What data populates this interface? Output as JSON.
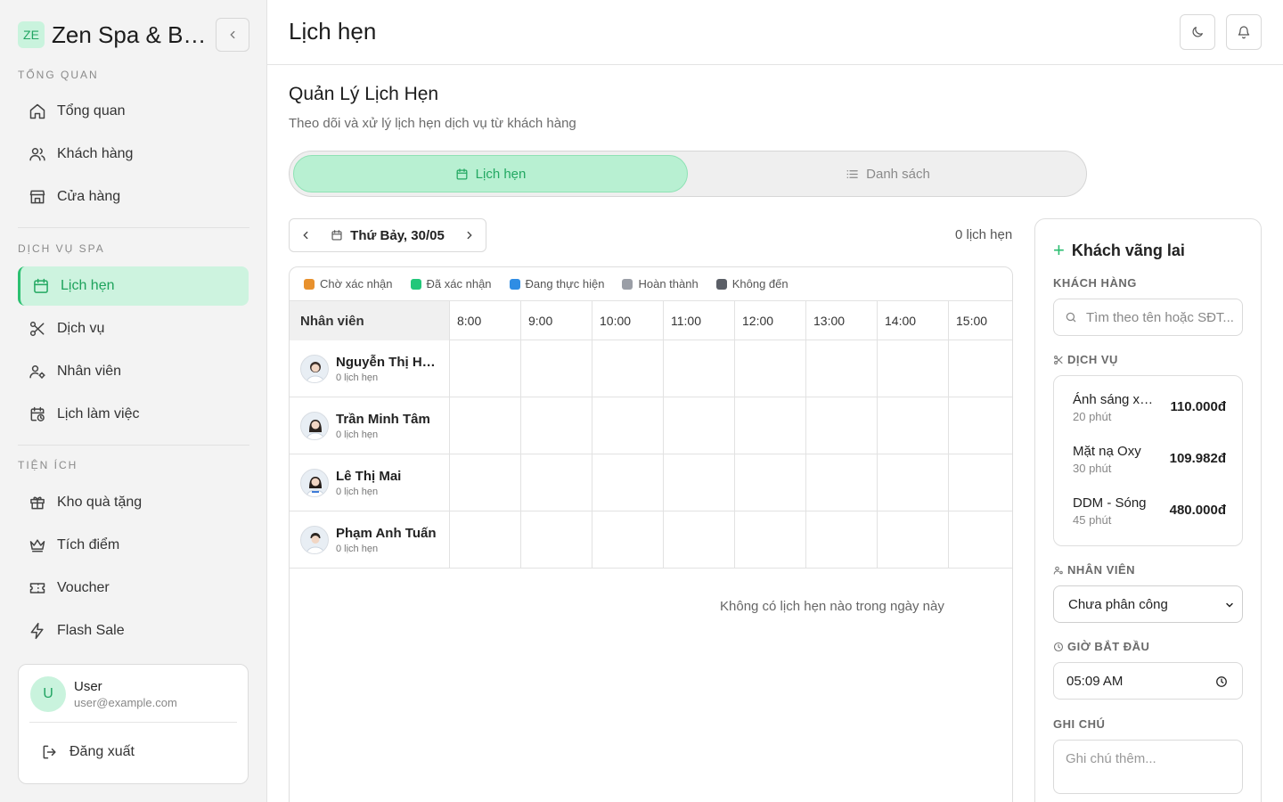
{
  "brand": {
    "badge": "ZE",
    "name": "Zen Spa & Beauty"
  },
  "sidebar": {
    "sections": [
      {
        "title": "TỔNG QUAN"
      },
      {
        "title": "DỊCH VỤ SPA"
      },
      {
        "title": "TIỆN ÍCH"
      }
    ],
    "items": [
      {
        "label": "Tổng quan",
        "icon": "home-icon"
      },
      {
        "label": "Khách hàng",
        "icon": "users-icon"
      },
      {
        "label": "Cửa hàng",
        "icon": "store-icon"
      },
      {
        "label": "Lịch hẹn",
        "icon": "calendar-icon",
        "active": true
      },
      {
        "label": "Dịch vụ",
        "icon": "scissors-icon"
      },
      {
        "label": "Nhân viên",
        "icon": "staff-icon"
      },
      {
        "label": "Lịch làm việc",
        "icon": "calendar-clock-icon"
      },
      {
        "label": "Kho quà tặng",
        "icon": "gift-icon"
      },
      {
        "label": "Tích điểm",
        "icon": "crown-icon"
      },
      {
        "label": "Voucher",
        "icon": "ticket-icon"
      },
      {
        "label": "Flash Sale",
        "icon": "zap-icon"
      }
    ],
    "user": {
      "avatar": "U",
      "name": "User",
      "email": "user@example.com",
      "logout": "Đăng xuất"
    }
  },
  "header": {
    "title": "Lịch hẹn"
  },
  "main": {
    "title": "Quản Lý Lịch Hẹn",
    "subtitle": "Theo dõi và xử lý lịch hẹn dịch vụ từ khách hàng",
    "tabs": [
      {
        "label": "Lịch hẹn"
      },
      {
        "label": "Danh sách"
      }
    ],
    "date": "Thứ Bảy, 30/05",
    "appointment_count": "0 lịch hẹn",
    "legend": [
      {
        "label": "Chờ xác nhận",
        "color": "#e8912d"
      },
      {
        "label": "Đã xác nhận",
        "color": "#22c77a"
      },
      {
        "label": "Đang thực hiện",
        "color": "#2f8de4"
      },
      {
        "label": "Hoàn thành",
        "color": "#9a9ea6"
      },
      {
        "label": "Không đến",
        "color": "#5b5f67"
      }
    ],
    "staff_header": "Nhân viên",
    "hours": [
      "8:00",
      "9:00",
      "10:00",
      "11:00",
      "12:00",
      "13:00",
      "14:00",
      "15:00"
    ],
    "staff": [
      {
        "name": "Nguyễn Thị Hồng",
        "count": "0 lịch hẹn"
      },
      {
        "name": "Trần Minh Tâm",
        "count": "0 lịch hẹn"
      },
      {
        "name": "Lê Thị Mai",
        "count": "0 lịch hẹn"
      },
      {
        "name": "Phạm Anh Tuấn",
        "count": "0 lịch hẹn"
      }
    ],
    "empty_message": "Không có lịch hẹn nào trong ngày này"
  },
  "panel": {
    "title": "Khách vãng lai",
    "customer_label": "KHÁCH HÀNG",
    "search_placeholder": "Tìm theo tên hoặc SĐT...",
    "service_label": "DỊCH VỤ",
    "services": [
      {
        "name": "Ánh sáng xanh",
        "duration": "20 phút",
        "price": "110.000đ"
      },
      {
        "name": "Mặt nạ Oxy",
        "duration": "30 phút",
        "price": "109.982đ"
      },
      {
        "name": "DDM - Sóng",
        "duration": "45 phút",
        "price": "480.000đ"
      }
    ],
    "staff_label": "NHÂN VIÊN",
    "staff_value": "Chưa phân công",
    "start_label": "GIỜ BẮT ĐẦU",
    "start_value": "05:09 AM",
    "note_label": "GHI CHÚ",
    "note_placeholder": "Ghi chú thêm..."
  }
}
